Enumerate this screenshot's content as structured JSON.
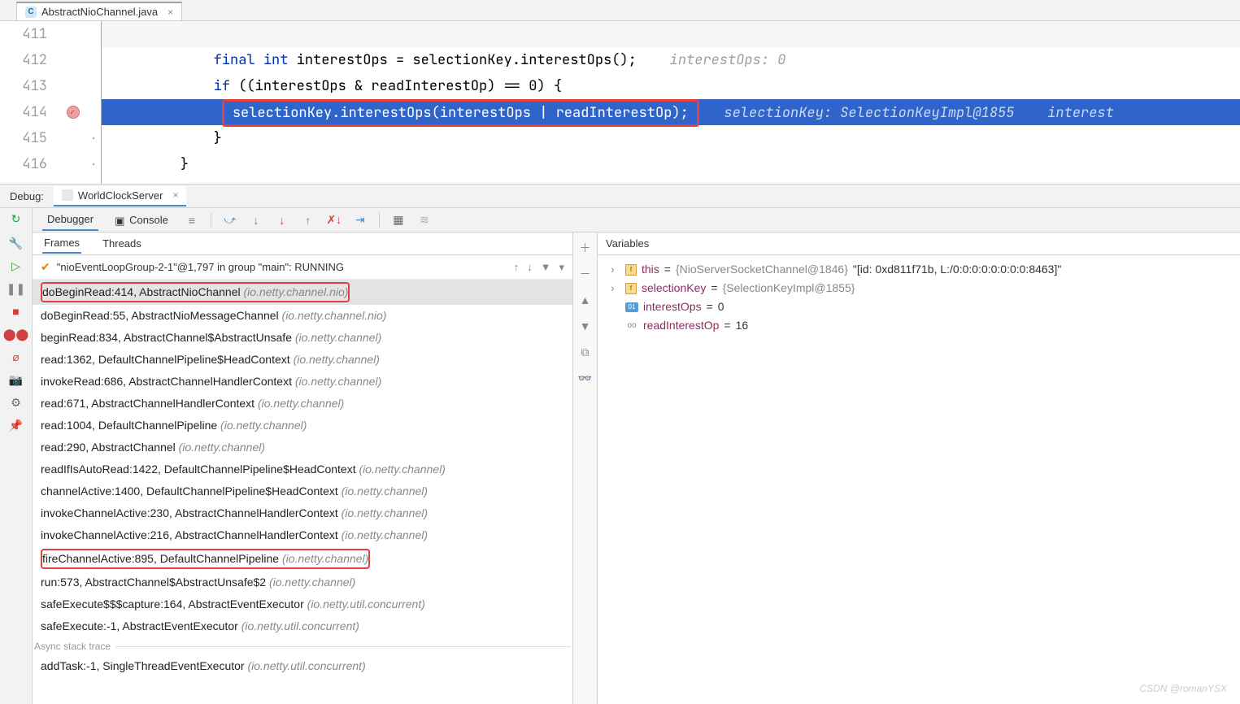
{
  "tab": {
    "filename": "AbstractNioChannel.java"
  },
  "editor": {
    "lines": [
      "411",
      "412",
      "413",
      "414",
      "415",
      "416"
    ],
    "code": {
      "l412_a": "final",
      "l412_b": "int",
      "l412_c": " interestOps = selectionKey.interestOps();",
      "l412_hint": "interestOps: 0",
      "l413_a": "if",
      "l413_b": " ((interestOps & readInterestOp) == 0) {",
      "l414_box": "selectionKey.interestOps(interestOps | readInterestOp);",
      "l414_hint": "selectionKey: SelectionKeyImpl@1855    interest",
      "l415": "}",
      "l416": "}"
    }
  },
  "debug": {
    "label": "Debug:",
    "config": "WorldClockServer",
    "tabs": {
      "debugger": "Debugger",
      "console": "Console"
    }
  },
  "frames": {
    "tabs": {
      "frames": "Frames",
      "threads": "Threads"
    },
    "thread": "\"nioEventLoopGroup-2-1\"@1,797 in group \"main\": RUNNING",
    "items": [
      {
        "main": "doBeginRead:414, AbstractNioChannel ",
        "pkg": "(io.netty.channel.nio)",
        "box": true,
        "sel": true
      },
      {
        "main": "doBeginRead:55, AbstractNioMessageChannel ",
        "pkg": "(io.netty.channel.nio)"
      },
      {
        "main": "beginRead:834, AbstractChannel$AbstractUnsafe ",
        "pkg": "(io.netty.channel)"
      },
      {
        "main": "read:1362, DefaultChannelPipeline$HeadContext ",
        "pkg": "(io.netty.channel)"
      },
      {
        "main": "invokeRead:686, AbstractChannelHandlerContext ",
        "pkg": "(io.netty.channel)"
      },
      {
        "main": "read:671, AbstractChannelHandlerContext ",
        "pkg": "(io.netty.channel)"
      },
      {
        "main": "read:1004, DefaultChannelPipeline ",
        "pkg": "(io.netty.channel)"
      },
      {
        "main": "read:290, AbstractChannel ",
        "pkg": "(io.netty.channel)"
      },
      {
        "main": "readIfIsAutoRead:1422, DefaultChannelPipeline$HeadContext ",
        "pkg": "(io.netty.channel)"
      },
      {
        "main": "channelActive:1400, DefaultChannelPipeline$HeadContext ",
        "pkg": "(io.netty.channel)"
      },
      {
        "main": "invokeChannelActive:230, AbstractChannelHandlerContext ",
        "pkg": "(io.netty.channel)"
      },
      {
        "main": "invokeChannelActive:216, AbstractChannelHandlerContext ",
        "pkg": "(io.netty.channel)"
      },
      {
        "main": "fireChannelActive:895, DefaultChannelPipeline ",
        "pkg": "(io.netty.channel)",
        "box": true
      },
      {
        "main": "run:573, AbstractChannel$AbstractUnsafe$2 ",
        "pkg": "(io.netty.channel)"
      },
      {
        "main": "safeExecute$$$capture:164, AbstractEventExecutor ",
        "pkg": "(io.netty.util.concurrent)"
      },
      {
        "main": "safeExecute:-1, AbstractEventExecutor ",
        "pkg": "(io.netty.util.concurrent)"
      }
    ],
    "async_label": "Async stack trace",
    "async_items": [
      {
        "main": "addTask:-1, SingleThreadEventExecutor ",
        "pkg": "(io.netty.util.concurrent)"
      }
    ]
  },
  "variables": {
    "header": "Variables",
    "items": [
      {
        "expand": true,
        "icon": "f",
        "name": "this",
        "eq": " = ",
        "val_gray": "{NioServerSocketChannel@1846}",
        "val": " \"[id: 0xd811f71b, L:/0:0:0:0:0:0:0:0:8463]\""
      },
      {
        "expand": true,
        "icon": "f",
        "name": "selectionKey",
        "eq": " = ",
        "val_gray": "{SelectionKeyImpl@1855}",
        "val": ""
      },
      {
        "expand": false,
        "icon": "01",
        "name": "interestOps",
        "eq": " = ",
        "val": "0",
        "val_gray": ""
      },
      {
        "expand": false,
        "icon": "oo",
        "name": "readInterestOp",
        "eq": " = ",
        "val": "16",
        "val_gray": ""
      }
    ]
  },
  "watermark": "CSDN @romanYSX"
}
